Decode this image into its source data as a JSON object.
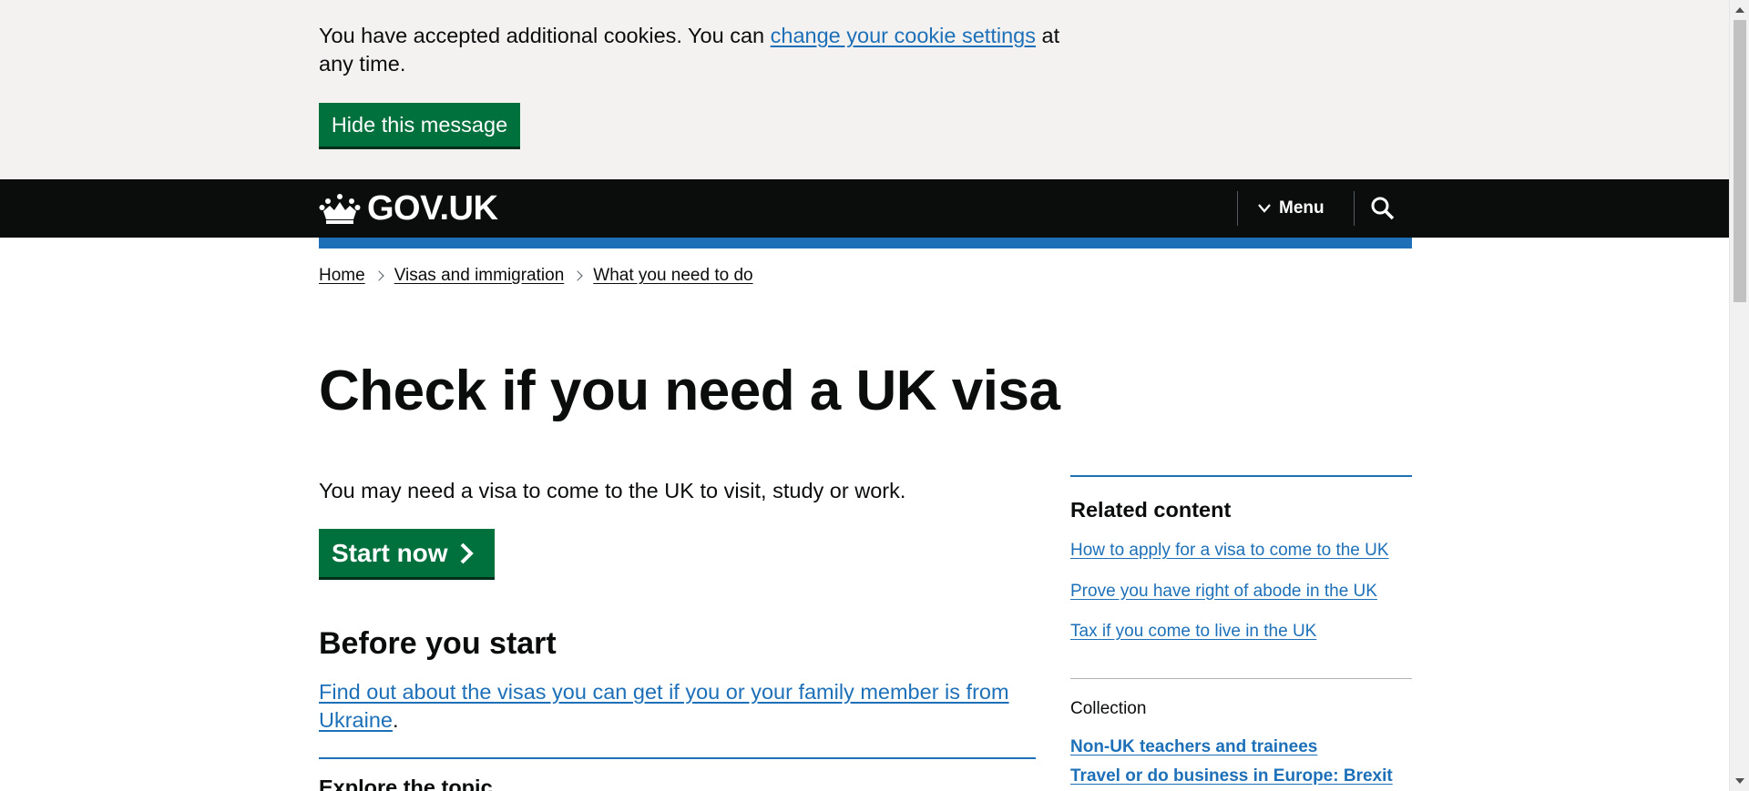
{
  "cookie_banner": {
    "text_before_link": "You have accepted additional cookies. You can ",
    "link_text": "change your cookie settings",
    "text_after_link": " at any time.",
    "hide_button": "Hide this message"
  },
  "header": {
    "logo_text": "GOV.UK",
    "logo_icon": "crown-icon",
    "menu_label": "Menu",
    "menu_icon": "chevron-down-icon",
    "search_icon": "search-icon"
  },
  "breadcrumb": [
    {
      "label": "Home"
    },
    {
      "label": "Visas and immigration"
    },
    {
      "label": "What you need to do"
    }
  ],
  "main": {
    "title": "Check if you need a UK visa",
    "lead": "You may need a visa to come to the UK to visit, study or work.",
    "start_button": "Start now",
    "start_icon": "chevron-right-icon",
    "before_heading": "Before you start",
    "ukraine_link": "Find out about the visas you can get if you or your family member is from Ukraine",
    "ukraine_suffix": ".",
    "explore_heading": "Explore the topic"
  },
  "sidebar": {
    "related_heading": "Related content",
    "related_links": [
      "How to apply for a visa to come to the UK",
      "Prove you have right of abode in the UK",
      "Tax if you come to live in the UK"
    ],
    "collection_label": "Collection",
    "collection_links": [
      "Non-UK teachers and trainees",
      "Travel or do business in Europe: Brexit"
    ]
  },
  "colors": {
    "green_button": "#00703c",
    "link_blue": "#1d70b8",
    "header_black": "#0b0c0c",
    "banner_grey": "#f3f2f1"
  }
}
